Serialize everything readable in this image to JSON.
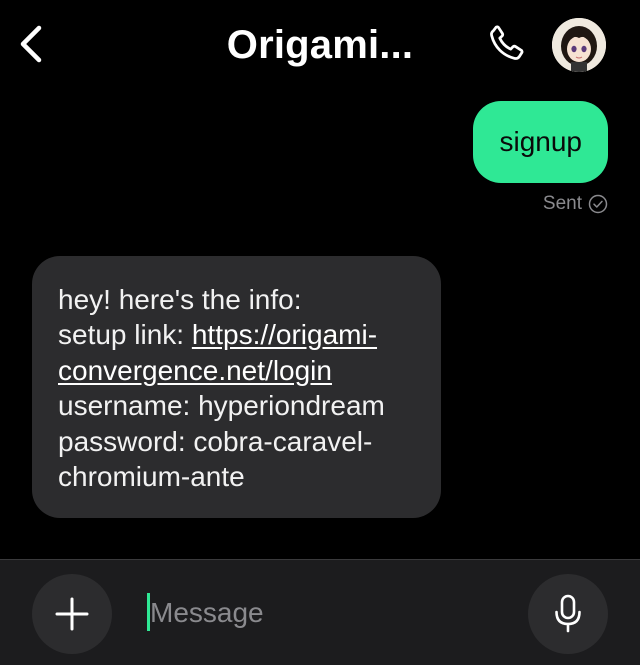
{
  "header": {
    "contact_name": "Origami...",
    "back_icon": "chevron-left-icon",
    "call_icon": "phone-icon",
    "avatar": "contact-avatar"
  },
  "conversation": {
    "outgoing": {
      "text": "signup",
      "status": "Sent",
      "status_icon": "check-circle-icon"
    },
    "incoming": {
      "line1": "hey! here's the info:",
      "setup_label": "setup link: ",
      "link_part1": "https://origami-",
      "link_part2": "convergence.net/login",
      "username_line": "username: hyperiondream",
      "password_line1": "password: cobra-caravel-",
      "password_line2": "chromium-ante"
    }
  },
  "compose": {
    "placeholder": "Message",
    "value": "",
    "add_icon": "plus-icon",
    "mic_icon": "microphone-icon"
  },
  "colors": {
    "background": "#000000",
    "outgoing_bubble": "#2fe895",
    "incoming_bubble": "#2c2c2e",
    "compose_bar": "#1c1c1e",
    "accent": "#2fe895"
  }
}
